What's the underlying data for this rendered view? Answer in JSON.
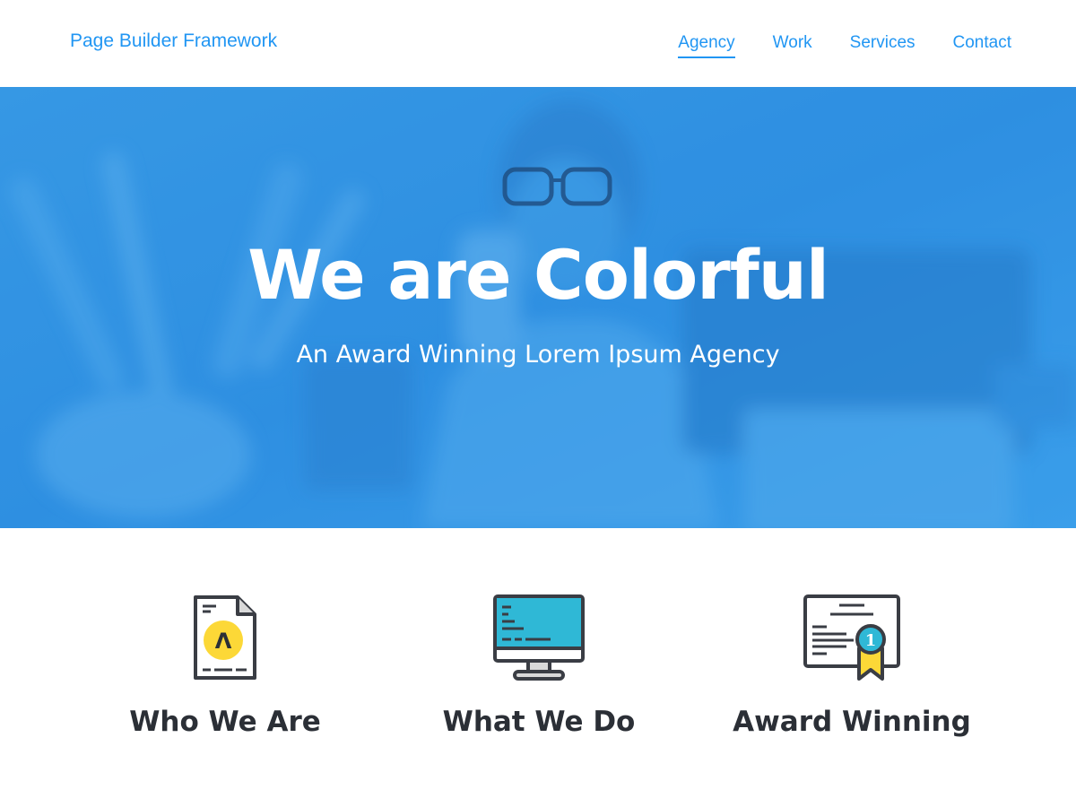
{
  "header": {
    "logo": "Page Builder Framework",
    "nav": [
      {
        "label": "Agency",
        "active": true
      },
      {
        "label": "Work",
        "active": false
      },
      {
        "label": "Services",
        "active": false
      },
      {
        "label": "Contact",
        "active": false
      }
    ]
  },
  "hero": {
    "title": "We are Colorful",
    "subtitle": "An Award Winning Lorem Ipsum Agency"
  },
  "features": [
    {
      "title": "Who We Are",
      "icon": "document-icon"
    },
    {
      "title": "What We Do",
      "icon": "monitor-icon"
    },
    {
      "title": "Award Winning",
      "icon": "certificate-icon"
    }
  ],
  "colors": {
    "accent": "#2196f3",
    "hero_overlay": "#2d8fe0",
    "heading": "#2b2f36",
    "icon_yellow": "#fcd837",
    "icon_teal": "#2fb8d6"
  },
  "icon_glyphs": {
    "document_badge": "Λ",
    "award_rank": "1"
  }
}
